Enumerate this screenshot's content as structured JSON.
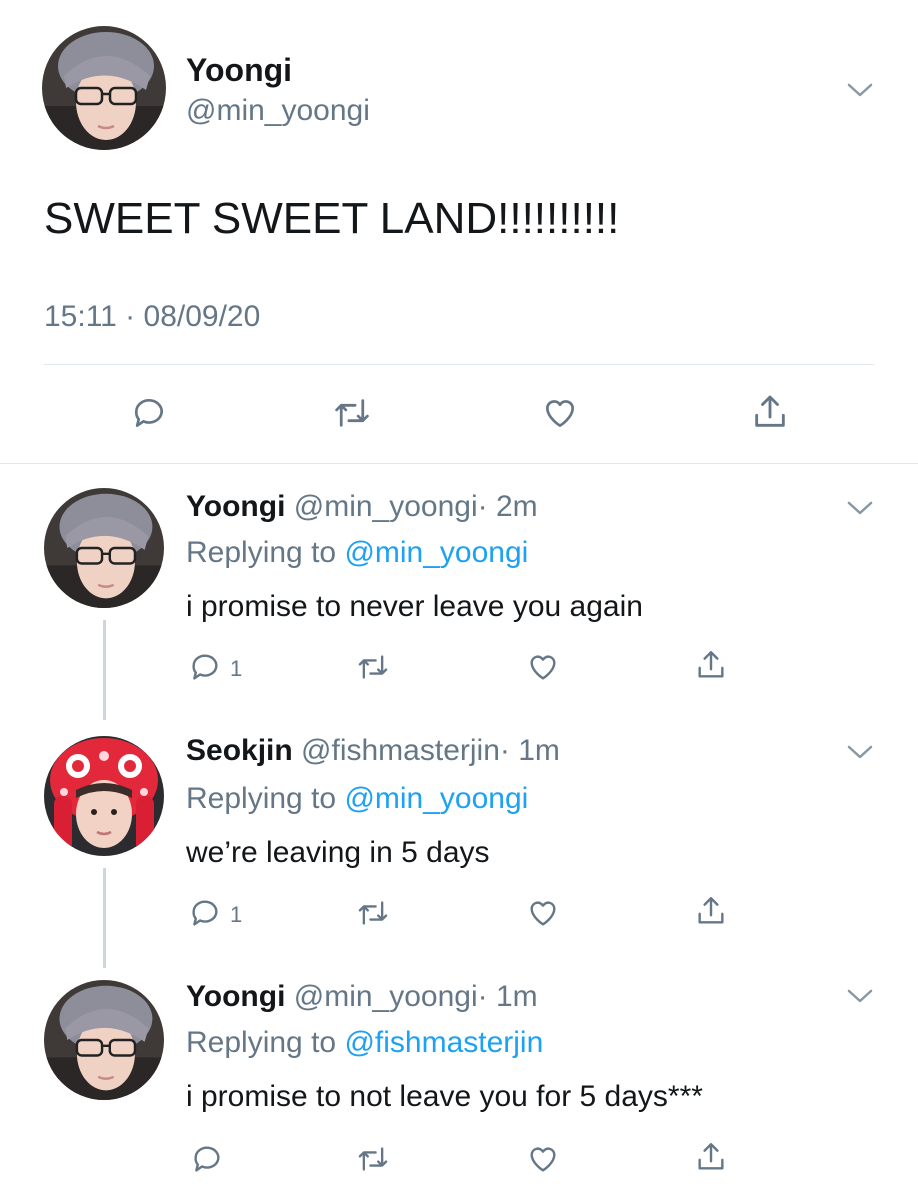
{
  "main_tweet": {
    "display_name": "Yoongi",
    "handle": "@min_yoongi",
    "text": "SWEET SWEET LAND!!!!!!!!!!",
    "timestamp": "15:11 · 08/09/20"
  },
  "replies": [
    {
      "display_name": "Yoongi",
      "handle": "@min_yoongi",
      "time": "· 2m",
      "replying_label": "Replying to",
      "replying_to": "@min_yoongi",
      "text": "i promise to never leave you again",
      "reply_count": "1"
    },
    {
      "display_name": "Seokjin",
      "handle": "@fishmasterjin",
      "time": "· 1m",
      "replying_label": "Replying to",
      "replying_to": "@min_yoongi",
      "text": "we’re leaving in 5 days",
      "reply_count": "1"
    },
    {
      "display_name": "Yoongi",
      "handle": "@min_yoongi",
      "time": "· 1m",
      "replying_label": "Replying to",
      "replying_to": "@fishmasterjin",
      "text": "i promise to not leave you for 5 days***",
      "reply_count": ""
    }
  ],
  "icons": [
    "reply-icon",
    "retweet-icon",
    "like-icon",
    "share-icon",
    "chevron-down-icon"
  ],
  "colors": {
    "text": "#14171a",
    "secondary": "#657786",
    "link": "#1da1f2",
    "divider": "#e1e8ed"
  }
}
